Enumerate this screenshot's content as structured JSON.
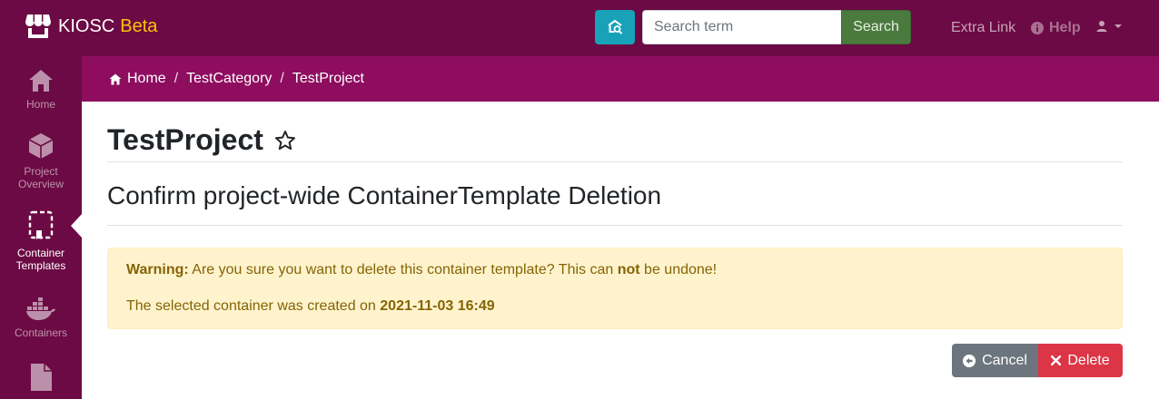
{
  "navbar": {
    "brand_name": "KIOSC",
    "brand_suffix": "Beta",
    "search_placeholder": "Search term",
    "search_button": "Search",
    "extra_link": "Extra Link",
    "help_link": "Help"
  },
  "sidebar": {
    "items": [
      {
        "label_line1": "Home",
        "label_line2": ""
      },
      {
        "label_line1": "Project",
        "label_line2": "Overview"
      },
      {
        "label_line1": "Container",
        "label_line2": "Templates"
      },
      {
        "label_line1": "Containers",
        "label_line2": ""
      }
    ]
  },
  "breadcrumb": {
    "items": [
      "Home",
      "TestCategory",
      "TestProject"
    ],
    "separator": "/"
  },
  "content": {
    "title": "TestProject",
    "subtitle": "Confirm project-wide ContainerTemplate Deletion",
    "warning_label": "Warning:",
    "warning_text_1": "Are you sure you want to delete this container template? This can",
    "warning_emphasis": "not",
    "warning_text_2": "be undone!",
    "created_text": "The selected container was created on",
    "created_date": "2021-11-03 16:49",
    "cancel_button": "Cancel",
    "delete_button": "Delete"
  },
  "colors": {
    "brand_dark": "#6b0a44",
    "breadcrumb_bg": "#8e0d5f",
    "beta": "#ffc107",
    "warning_bg": "#fff3cd",
    "danger": "#dc3545",
    "secondary": "#6c757d"
  },
  "icons": {
    "brand": "store-icon",
    "advanced_search": "search-settings-icon",
    "help": "info-circle-icon",
    "user": "user-icon",
    "star": "star-outline-icon"
  }
}
